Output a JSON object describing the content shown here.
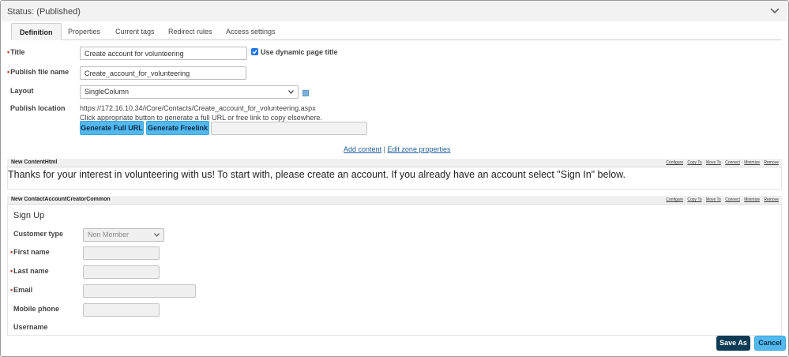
{
  "status": {
    "text": "Status: (Published)"
  },
  "tabs": [
    {
      "label": "Definition"
    },
    {
      "label": "Properties"
    },
    {
      "label": "Current tags"
    },
    {
      "label": "Redirect rules"
    },
    {
      "label": "Access settings"
    }
  ],
  "form": {
    "title_label": "Title",
    "title_value": "Create account for volunteering",
    "dynamic_title_label": "Use dynamic page title",
    "dynamic_title_checked": true,
    "publish_file_label": "Publish file name",
    "publish_file_value": "Create_account_for_volunteering",
    "layout_label": "Layout",
    "layout_value": "SingleColumn",
    "publish_location_label": "Publish location",
    "publish_location_url": "https://172.16.10.34/iCore/Contacts/Create_account_for_volunteering.aspx",
    "publish_location_hint": "Click appropriate button to generate a full URL or free link to copy elsewhere.",
    "generate_full_url": "Generate Full URL",
    "generate_freelink": "Generate Freelink",
    "generated_link_value": ""
  },
  "zone_links": {
    "add_content": "Add content",
    "separator": "|",
    "edit_zone": "Edit zone properties"
  },
  "content_actions": [
    "Configure",
    "Copy To",
    "Move To",
    "Connect",
    "Minimize",
    "Remove"
  ],
  "content_html": {
    "title": "New ContentHtml",
    "body": "Thanks for your interest in volunteering with us! To start with, please create an account. If you already have an account select \"Sign In\" below."
  },
  "account_creator": {
    "title": "New ContactAccountCreatorCommon",
    "heading": "Sign Up",
    "customer_type_label": "Customer type",
    "customer_type_value": "Non Member",
    "first_name_label": "First name",
    "last_name_label": "Last name",
    "email_label": "Email",
    "mobile_phone_label": "Mobile phone",
    "username_label": "Username"
  },
  "footer": {
    "save_as": "Save As",
    "cancel": "Cancel"
  },
  "colors": {
    "accent": "#52b9f0",
    "dark_button": "#0e3b55",
    "required": "#c0392b",
    "link": "#1f5f9a"
  }
}
